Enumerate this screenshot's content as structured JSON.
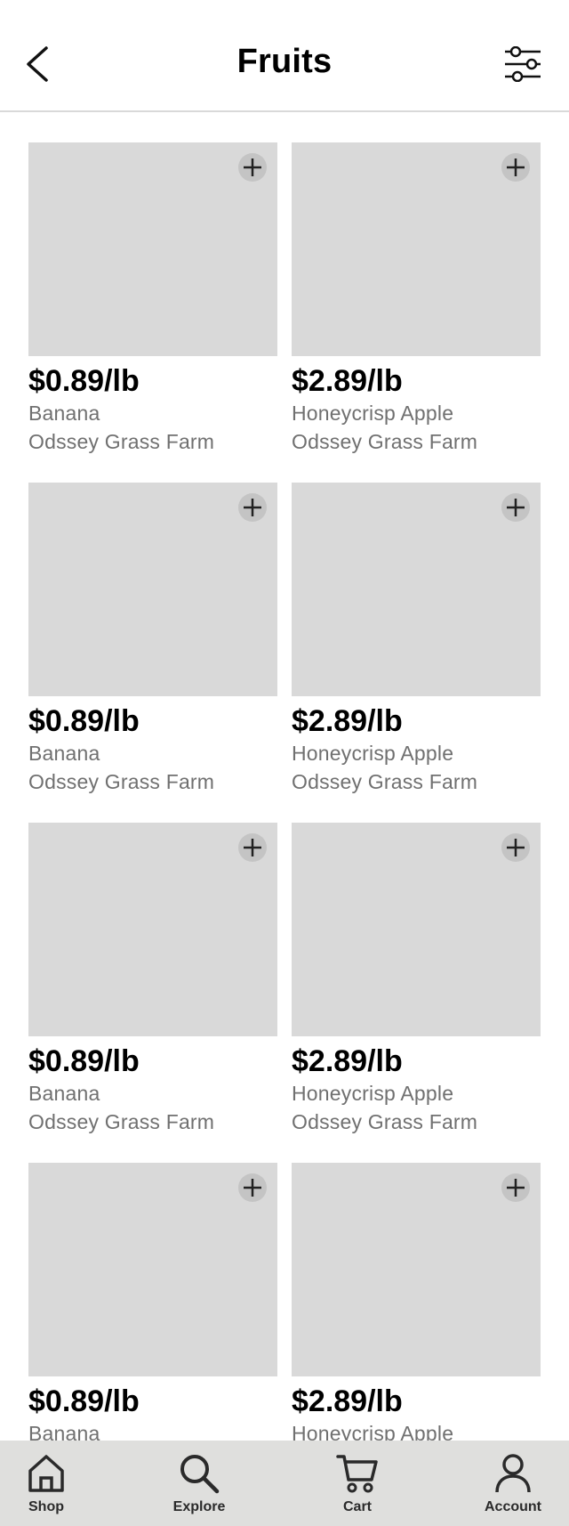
{
  "header": {
    "title": "Fruits",
    "back_icon": "chevron-left-icon",
    "filter_icon": "sliders-icon"
  },
  "products": [
    {
      "price": "$0.89/lb",
      "name": "Banana",
      "farm": "Odssey Grass Farm"
    },
    {
      "price": "$2.89/lb",
      "name": "Honeycrisp Apple",
      "farm": "Odssey Grass Farm"
    },
    {
      "price": "$0.89/lb",
      "name": "Banana",
      "farm": "Odssey Grass Farm"
    },
    {
      "price": "$2.89/lb",
      "name": "Honeycrisp Apple",
      "farm": "Odssey Grass Farm"
    },
    {
      "price": "$0.89/lb",
      "name": "Banana",
      "farm": "Odssey Grass Farm"
    },
    {
      "price": "$2.89/lb",
      "name": "Honeycrisp Apple",
      "farm": "Odssey Grass Farm"
    },
    {
      "price": "$0.89/lb",
      "name": "Banana",
      "farm": ""
    },
    {
      "price": "$2.89/lb",
      "name": "Honeycrisp Apple",
      "farm": ""
    }
  ],
  "nav": {
    "items": [
      {
        "label": "Shop",
        "icon": "home-icon"
      },
      {
        "label": "Explore",
        "icon": "search-icon"
      },
      {
        "label": "Cart",
        "icon": "cart-icon"
      },
      {
        "label": "Account",
        "icon": "user-icon"
      }
    ]
  },
  "colors": {
    "placeholder": "#d9d9d9",
    "add_button": "#c4c4c4",
    "secondary_text": "#707070",
    "nav_background": "#dfdfdd"
  }
}
